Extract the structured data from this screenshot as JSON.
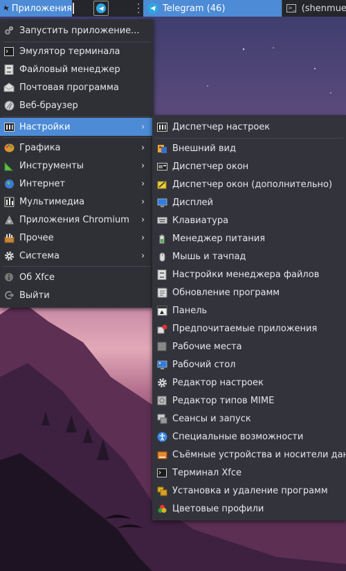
{
  "panel": {
    "apps_label": "Приложения",
    "tasks": [
      {
        "label": "Telegram (46)",
        "icon": "telegram-icon",
        "active": true
      },
      {
        "label": "(shenmue",
        "icon": "terminal-icon",
        "active": false
      }
    ]
  },
  "main_menu": {
    "items": [
      {
        "label": "Запустить приложение...",
        "icon": "gears-icon"
      },
      {
        "label": "Эмулятор терминала",
        "icon": "terminal-icon"
      },
      {
        "label": "Файловый менеджер",
        "icon": "file-cabinet-icon"
      },
      {
        "label": "Почтовая программа",
        "icon": "mail-icon"
      },
      {
        "label": "Веб-браузер",
        "icon": "globe-icon"
      },
      {
        "label": "Настройки",
        "icon": "settings-panel-icon",
        "submenu": true
      },
      {
        "label": "Графика",
        "icon": "palette-icon",
        "submenu": true
      },
      {
        "label": "Инструменты",
        "icon": "ruler-icon",
        "submenu": true
      },
      {
        "label": "Интернет",
        "icon": "earth-icon",
        "submenu": true
      },
      {
        "label": "Мультимедиа",
        "icon": "film-icon",
        "submenu": true
      },
      {
        "label": "Приложения Chromium",
        "icon": "chromium-icon",
        "submenu": true
      },
      {
        "label": "Прочее",
        "icon": "toolbox-icon",
        "submenu": true
      },
      {
        "label": "Система",
        "icon": "gear-icon",
        "submenu": true
      },
      {
        "label": "Об Xfce",
        "icon": "info-icon"
      },
      {
        "label": "Выйти",
        "icon": "logout-icon"
      }
    ]
  },
  "settings_menu": {
    "items": [
      {
        "label": "Диспетчер настроек",
        "icon": "settings-manager-icon"
      },
      {
        "label": "Внешний вид",
        "icon": "appearance-icon"
      },
      {
        "label": "Диспетчер окон",
        "icon": "window-manager-icon"
      },
      {
        "label": "Диспетчер окон (дополнительно)",
        "icon": "window-manager-tweaks-icon"
      },
      {
        "label": "Дисплей",
        "icon": "display-icon"
      },
      {
        "label": "Клавиатура",
        "icon": "keyboard-icon"
      },
      {
        "label": "Менеджер питания",
        "icon": "battery-icon"
      },
      {
        "label": "Мышь и тачпад",
        "icon": "mouse-icon"
      },
      {
        "label": "Настройки менеджера файлов",
        "icon": "file-manager-icon"
      },
      {
        "label": "Обновление программ",
        "icon": "software-update-icon"
      },
      {
        "label": "Панель",
        "icon": "panel-icon"
      },
      {
        "label": "Предпочитаемые приложения",
        "icon": "preferred-apps-icon"
      },
      {
        "label": "Рабочие места",
        "icon": "workspaces-icon"
      },
      {
        "label": "Рабочий стол",
        "icon": "desktop-icon"
      },
      {
        "label": "Редактор настроек",
        "icon": "gear-icon"
      },
      {
        "label": "Редактор типов MIME",
        "icon": "mime-editor-icon"
      },
      {
        "label": "Сеансы и запуск",
        "icon": "session-icon"
      },
      {
        "label": "Специальные возможности",
        "icon": "accessibility-icon"
      },
      {
        "label": "Съёмные устройства и носители данн",
        "icon": "removable-drive-icon"
      },
      {
        "label": "Терминал Xfce",
        "icon": "terminal-icon"
      },
      {
        "label": "Установка и удаление программ",
        "icon": "package-icon"
      },
      {
        "label": "Цветовые профили",
        "icon": "color-profile-icon"
      }
    ]
  }
}
